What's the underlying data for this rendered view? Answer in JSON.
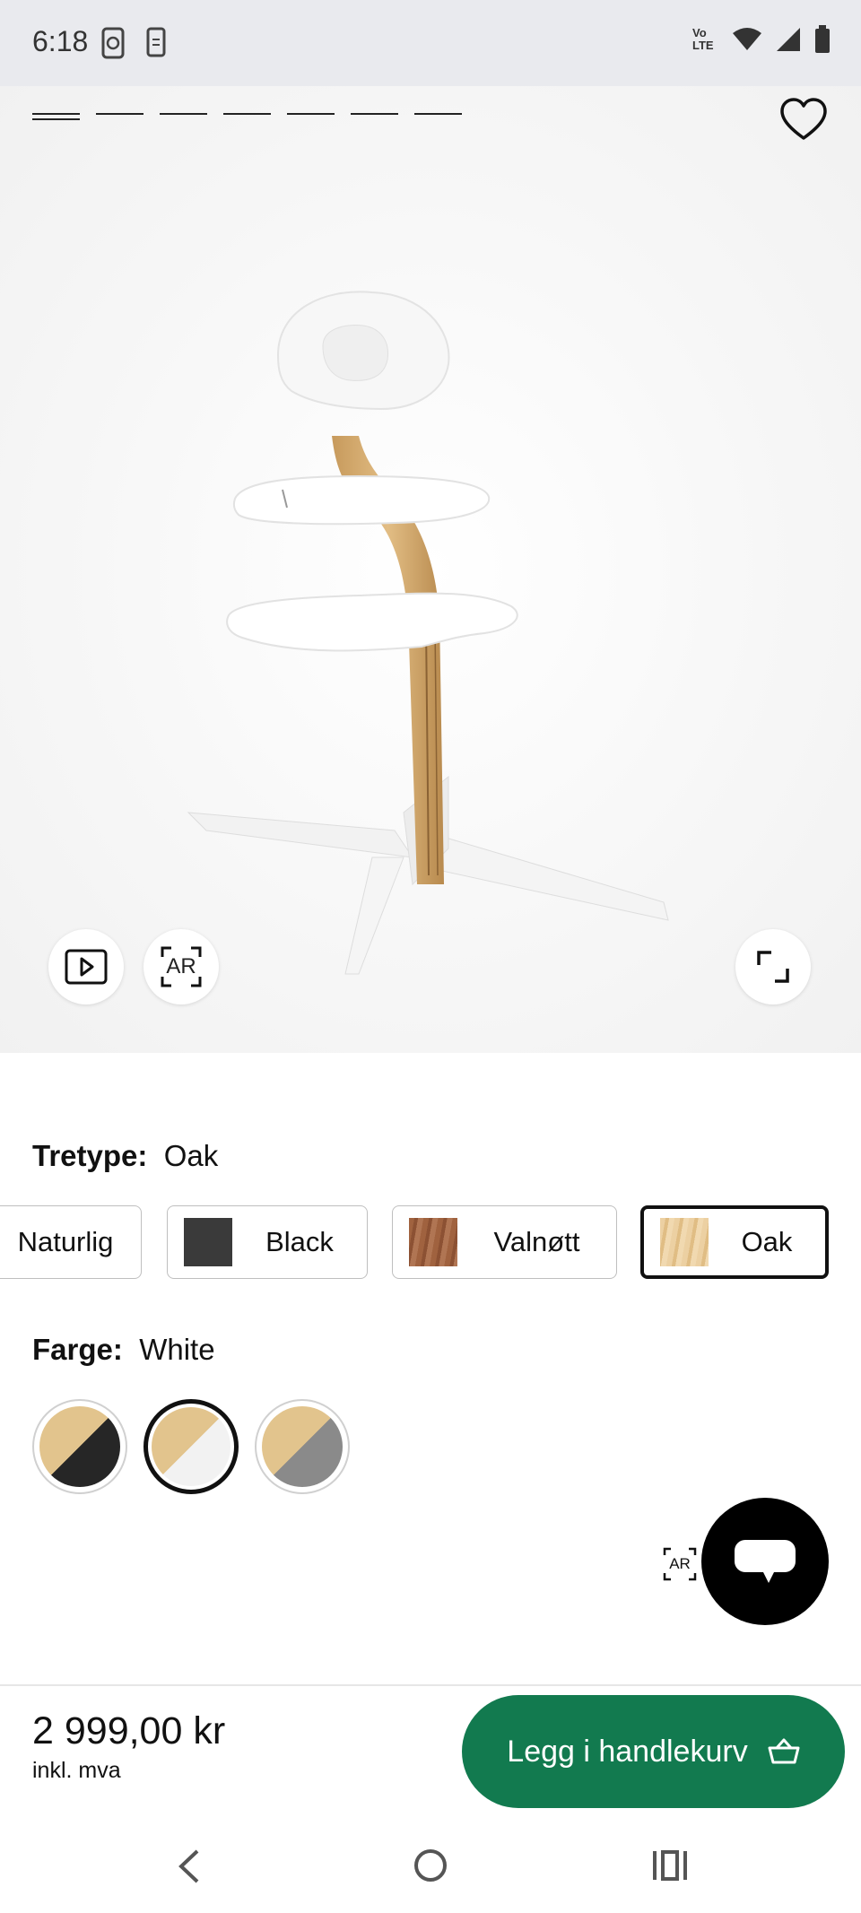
{
  "status_bar": {
    "time": "6:18",
    "network_label": "Vo LTE",
    "icons": [
      "data-saver-icon",
      "phone-clipboard-icon",
      "volte-icon",
      "wifi-icon",
      "signal-icon",
      "battery-icon"
    ]
  },
  "gallery": {
    "images_count": 7,
    "active_index": 0,
    "ar_label": "AR",
    "buttons": [
      "video-button",
      "ar-button",
      "fullscreen-button"
    ],
    "favorite_icon": "heart-icon"
  },
  "wood_type": {
    "label": "Tretype:",
    "value": "Oak",
    "options": [
      {
        "name": "Naturlig",
        "swatch": "#e9d3a9"
      },
      {
        "name": "Black",
        "swatch": "#3a3a3a"
      },
      {
        "name": "Valnøtt",
        "swatch": "#9c5e3e"
      },
      {
        "name": "Oak",
        "swatch": "#e8c99a",
        "selected": true
      }
    ]
  },
  "color": {
    "label": "Farge:",
    "value": "White",
    "options": [
      {
        "name": "Black",
        "wood": "#e2c48d",
        "color": "#262626"
      },
      {
        "name": "White",
        "wood": "#e2c48d",
        "color": "#f2f2f2",
        "selected": true
      },
      {
        "name": "Grey",
        "wood": "#e2c48d",
        "color": "#8a8a8a"
      }
    ]
  },
  "floating": {
    "ar_label": "AR",
    "chat_icon": "chat-bubble-icon"
  },
  "purchase": {
    "price": "2 999,00 kr",
    "price_note": "inkl. mva",
    "cart_button": "Legg i handlekurv",
    "cart_icon": "basket-icon",
    "button_color": "#127a4f"
  },
  "nav": {
    "items": [
      "back-icon",
      "home-icon",
      "recents-icon"
    ]
  }
}
